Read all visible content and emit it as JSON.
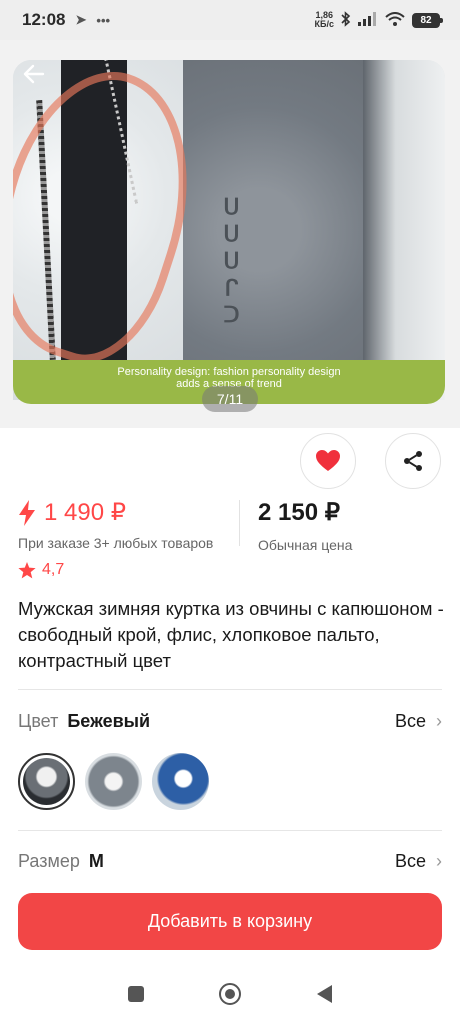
{
  "status_bar": {
    "time": "12:08",
    "speed_value": "1,86",
    "speed_unit": "КБ/с",
    "battery": "82"
  },
  "gallery": {
    "banner_line1": "Personality design: fashion personality design",
    "banner_line2": "adds a sense of trend",
    "counter": "7/11",
    "emboss_text": "ᑕᒍᑎᑎᑎ"
  },
  "pricing": {
    "promo_price": "1 490 ₽",
    "promo_note": "При заказе 3+ любых товаров",
    "regular_price": "2 150 ₽",
    "regular_note": "Обычная цена"
  },
  "rating": "4,7",
  "product_title": "Мужская зимняя куртка из овчины с капюшоном - свободный крой, флис, хлопковое пальто, контрастный цвет",
  "color_option": {
    "label": "Цвет",
    "value": "Бежевый",
    "all": "Все"
  },
  "size_option": {
    "label": "Размер",
    "value": "M",
    "all": "Все"
  },
  "cart_button": "Добавить в корзину",
  "colors": {
    "accent": "#ff4747",
    "cart": "#f24646",
    "banner": "#99b847"
  }
}
